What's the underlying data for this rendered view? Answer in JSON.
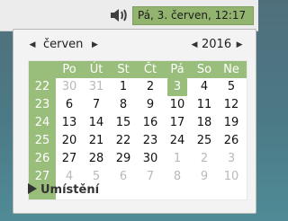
{
  "panel": {
    "clock_text": "Pá,  3. červen, 12:17"
  },
  "calendar": {
    "month": "červen",
    "year": "2016",
    "weekday_headers": [
      "Po",
      "Út",
      "St",
      "Čt",
      "Pá",
      "So",
      "Ne"
    ],
    "week_numbers": [
      "22",
      "23",
      "24",
      "25",
      "26",
      "27"
    ],
    "rows": [
      [
        "30",
        "31",
        "1",
        "2",
        "3",
        "4",
        "5"
      ],
      [
        "6",
        "7",
        "8",
        "9",
        "10",
        "11",
        "12"
      ],
      [
        "13",
        "14",
        "15",
        "16",
        "17",
        "18",
        "19"
      ],
      [
        "20",
        "21",
        "22",
        "23",
        "24",
        "25",
        "26"
      ],
      [
        "27",
        "28",
        "29",
        "30",
        "1",
        "2",
        "3"
      ],
      [
        "4",
        "5",
        "6",
        "7",
        "8",
        "9",
        "10"
      ]
    ],
    "muted": [
      [
        true,
        true,
        false,
        false,
        false,
        false,
        false
      ],
      [
        false,
        false,
        false,
        false,
        false,
        false,
        false
      ],
      [
        false,
        false,
        false,
        false,
        false,
        false,
        false
      ],
      [
        false,
        false,
        false,
        false,
        false,
        false,
        false
      ],
      [
        false,
        false,
        false,
        false,
        true,
        true,
        true
      ],
      [
        true,
        true,
        true,
        true,
        true,
        true,
        true
      ]
    ],
    "today": {
      "row": 0,
      "col": 4
    }
  },
  "location": {
    "label": "Umístění"
  },
  "colors": {
    "accent": "#99bd7b",
    "clock_bg": "#93b46f"
  },
  "icons": {
    "volume": "volume-icon",
    "prev_month": "triangle-left-icon",
    "next_month": "triangle-right-icon",
    "prev_year": "triangle-left-icon",
    "next_year": "triangle-right-icon",
    "location_expander": "triangle-right-icon"
  }
}
